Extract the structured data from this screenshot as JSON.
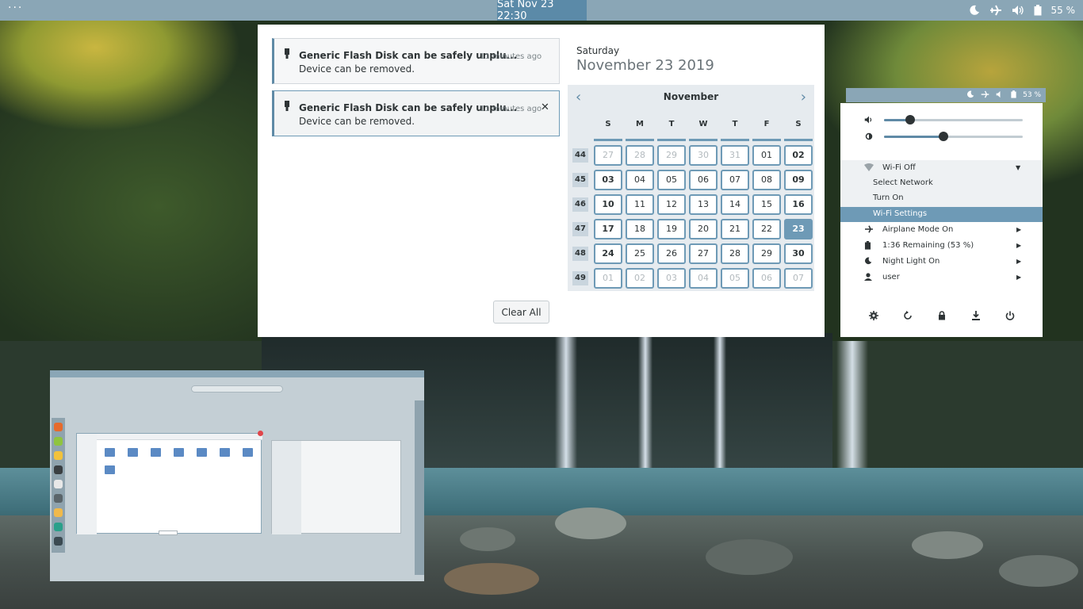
{
  "topbar": {
    "activities": "···",
    "clock": "Sat Nov 23  22:30",
    "battery": "55 %"
  },
  "notifications": [
    {
      "title": "Generic Flash Disk can be safely unplu...",
      "time": "11 minutes ago",
      "body": "Device can be removed."
    },
    {
      "title": "Generic Flash Disk can be safely unplu...",
      "time": "11 minutes ago",
      "body": "Device can be removed."
    }
  ],
  "clear_all": "Clear All",
  "date_header": {
    "day": "Saturday",
    "date": "November 23 2019"
  },
  "calendar": {
    "month": "November",
    "weekdays": [
      "S",
      "M",
      "T",
      "W",
      "T",
      "F",
      "S"
    ],
    "weeks": [
      "44",
      "45",
      "46",
      "47",
      "48",
      "49"
    ],
    "days": [
      [
        "27",
        "28",
        "29",
        "30",
        "31",
        "01",
        "02"
      ],
      [
        "03",
        "04",
        "05",
        "06",
        "07",
        "08",
        "09"
      ],
      [
        "10",
        "11",
        "12",
        "13",
        "14",
        "15",
        "16"
      ],
      [
        "17",
        "18",
        "19",
        "20",
        "21",
        "22",
        "23"
      ],
      [
        "24",
        "25",
        "26",
        "27",
        "28",
        "29",
        "30"
      ],
      [
        "01",
        "02",
        "03",
        "04",
        "05",
        "06",
        "07"
      ]
    ],
    "other_month": [
      [
        true,
        true,
        true,
        true,
        true,
        false,
        false
      ],
      [
        false,
        false,
        false,
        false,
        false,
        false,
        false
      ],
      [
        false,
        false,
        false,
        false,
        false,
        false,
        false
      ],
      [
        false,
        false,
        false,
        false,
        false,
        false,
        false
      ],
      [
        false,
        false,
        false,
        false,
        false,
        false,
        false
      ],
      [
        true,
        true,
        true,
        true,
        true,
        true,
        true
      ]
    ],
    "today": "23"
  },
  "system_menu": {
    "bar_battery": "53 %",
    "volume_level": 0.19,
    "brightness_level": 0.43,
    "wifi": "Wi-Fi Off",
    "wifi_sub": [
      "Select Network",
      "Turn On",
      "Wi-Fi Settings"
    ],
    "airplane": "Airplane Mode On",
    "battery": "1:36 Remaining (53 %)",
    "night_light": "Night Light On",
    "user": "user"
  },
  "colors": {
    "accent": "#6e9ab6",
    "topbar": "#8aa6b6",
    "clock_bg": "#5b8aa8"
  }
}
